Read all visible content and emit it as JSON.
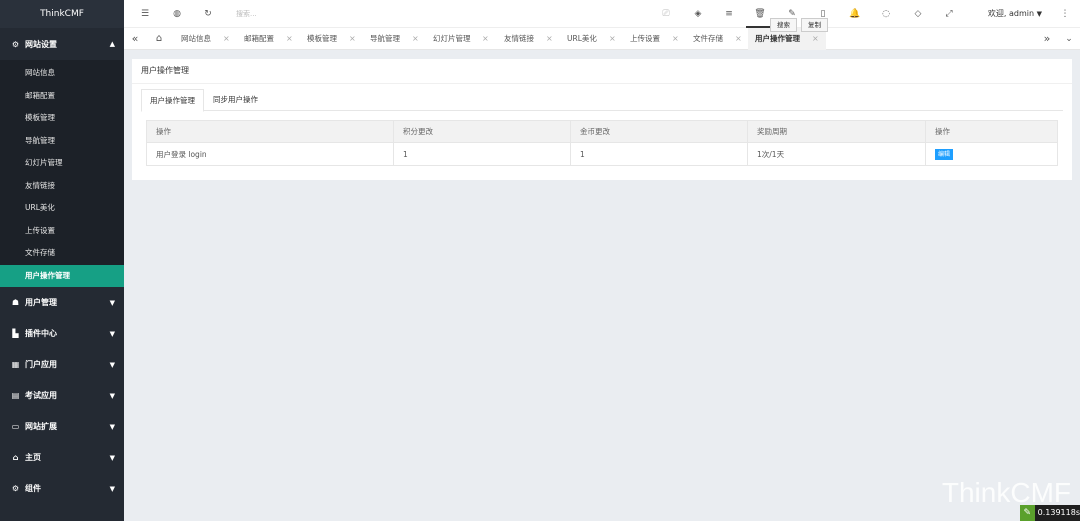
{
  "brand": "ThinkCMF",
  "sidebar": {
    "open_group": {
      "label": "网站设置",
      "icon": "gears-icon"
    },
    "subitems": [
      {
        "label": "网站信息"
      },
      {
        "label": "邮箱配置"
      },
      {
        "label": "模板管理"
      },
      {
        "label": "导航管理"
      },
      {
        "label": "幻灯片管理"
      },
      {
        "label": "友情链接"
      },
      {
        "label": "URL美化"
      },
      {
        "label": "上传设置"
      },
      {
        "label": "文件存储"
      },
      {
        "label": "用户操作管理",
        "active": true
      }
    ],
    "groups": [
      {
        "label": "用户管理",
        "icon": "users-icon",
        "glyph": "👥"
      },
      {
        "label": "插件中心",
        "icon": "plug-icon",
        "glyph": "🔌"
      },
      {
        "label": "门户应用",
        "icon": "grid-icon",
        "glyph": "▦"
      },
      {
        "label": "考试应用",
        "icon": "file-icon",
        "glyph": "▤"
      },
      {
        "label": "网站扩展",
        "icon": "monitor-icon",
        "glyph": "▭"
      },
      {
        "label": "主页",
        "icon": "home-icon",
        "glyph": "⌂"
      },
      {
        "label": "组件",
        "icon": "cog-icon",
        "glyph": "⚙"
      }
    ]
  },
  "topbar": {
    "search_placeholder": "搜索...",
    "welcome": "欢迎, admin",
    "tooltips": {
      "search": "搜索",
      "copy": "复制"
    }
  },
  "tabs": [
    {
      "label": "网站信息"
    },
    {
      "label": "邮箱配置"
    },
    {
      "label": "模板管理"
    },
    {
      "label": "导航管理"
    },
    {
      "label": "幻灯片管理"
    },
    {
      "label": "友情链接"
    },
    {
      "label": "URL美化"
    },
    {
      "label": "上传设置"
    },
    {
      "label": "文件存储"
    },
    {
      "label": "用户操作管理",
      "active": true
    }
  ],
  "main": {
    "page_title": "用户操作管理",
    "subtabs": [
      {
        "label": "用户操作管理",
        "active": true
      },
      {
        "label": "同步用户操作"
      }
    ],
    "table": {
      "headers": [
        "操作",
        "积分更改",
        "金币更改",
        "奖励周期",
        "操作"
      ],
      "rows": [
        {
          "action": "用户登录 login",
          "score": "1",
          "coin": "1",
          "cycle": "1次/1天",
          "edit": "编辑"
        }
      ]
    }
  },
  "watermark": "ThinkCMF",
  "timer": "0.139118s",
  "colors": {
    "sidebar_bg": "#242a33",
    "active_green": "#16a085",
    "edit_blue": "#1e9fff"
  }
}
